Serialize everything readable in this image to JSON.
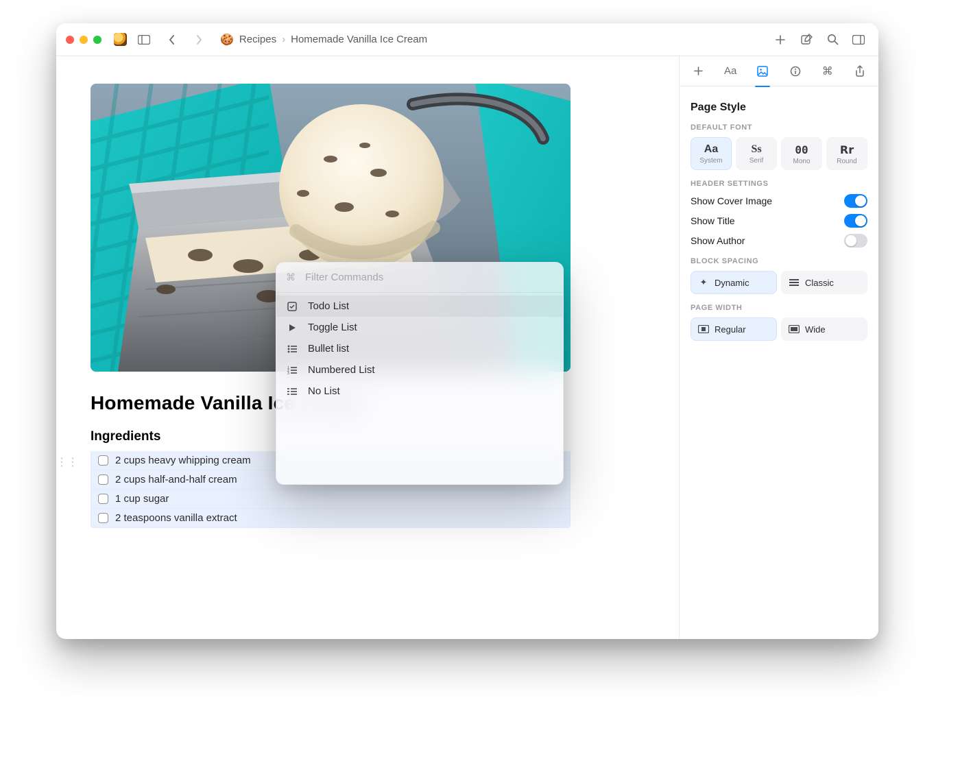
{
  "breadcrumb": {
    "parent_icon": "cookie",
    "parent": "Recipes",
    "current": "Homemade Vanilla Ice Cream"
  },
  "document": {
    "title": "Homemade Vanilla Ice Cream",
    "ingredients_heading": "Ingredients",
    "ingredients": [
      "2 cups heavy whipping cream",
      "2 cups half-and-half cream",
      "1 cup sugar",
      "2 teaspoons vanilla extract"
    ]
  },
  "palette": {
    "placeholder": "Filter Commands",
    "items": [
      {
        "icon": "checkbox",
        "label": "Todo List",
        "selected": true
      },
      {
        "icon": "play",
        "label": "Toggle List"
      },
      {
        "icon": "bullets",
        "label": "Bullet list"
      },
      {
        "icon": "numbers",
        "label": "Numbered List"
      },
      {
        "icon": "nolist",
        "label": "No List"
      }
    ]
  },
  "inspector": {
    "title": "Page Style",
    "sections": {
      "font_label": "DEFAULT FONT",
      "fonts": [
        {
          "sample": "Aa",
          "name": "System",
          "active": true,
          "cls": "system"
        },
        {
          "sample": "Ss",
          "name": "Serif",
          "active": false,
          "cls": "serif"
        },
        {
          "sample": "00",
          "name": "Mono",
          "active": false,
          "cls": "mono"
        },
        {
          "sample": "Rr",
          "name": "Round",
          "active": false,
          "cls": "round"
        }
      ],
      "header_label": "HEADER SETTINGS",
      "header_rows": [
        {
          "label": "Show Cover Image",
          "on": true
        },
        {
          "label": "Show Title",
          "on": true
        },
        {
          "label": "Show Author",
          "on": false
        }
      ],
      "spacing_label": "BLOCK SPACING",
      "spacing": [
        {
          "icon": "sparkle",
          "label": "Dynamic",
          "active": true
        },
        {
          "icon": "lines",
          "label": "Classic",
          "active": false
        }
      ],
      "width_label": "PAGE WIDTH",
      "width": [
        {
          "icon": "rect-narrow",
          "label": "Regular",
          "active": true
        },
        {
          "icon": "rect-wide",
          "label": "Wide",
          "active": false
        }
      ]
    }
  }
}
